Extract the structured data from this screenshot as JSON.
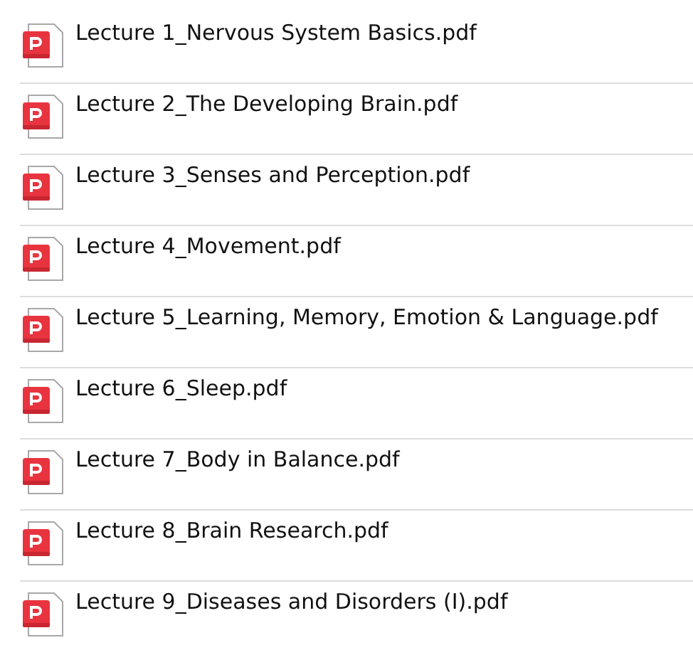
{
  "files": [
    {
      "name": "Lecture 1_Nervous System Basics.pdf"
    },
    {
      "name": "Lecture 2_The Developing Brain.pdf"
    },
    {
      "name": "Lecture 3_Senses and Perception.pdf"
    },
    {
      "name": "Lecture 4_Movement.pdf"
    },
    {
      "name": "Lecture 5_Learning, Memory, Emotion & Language.pdf"
    },
    {
      "name": "Lecture 6_Sleep.pdf"
    },
    {
      "name": "Lecture 7_Body in Balance.pdf"
    },
    {
      "name": "Lecture 8_Brain Research.pdf"
    },
    {
      "name": "Lecture 9_Diseases and Disorders (I).pdf"
    }
  ]
}
